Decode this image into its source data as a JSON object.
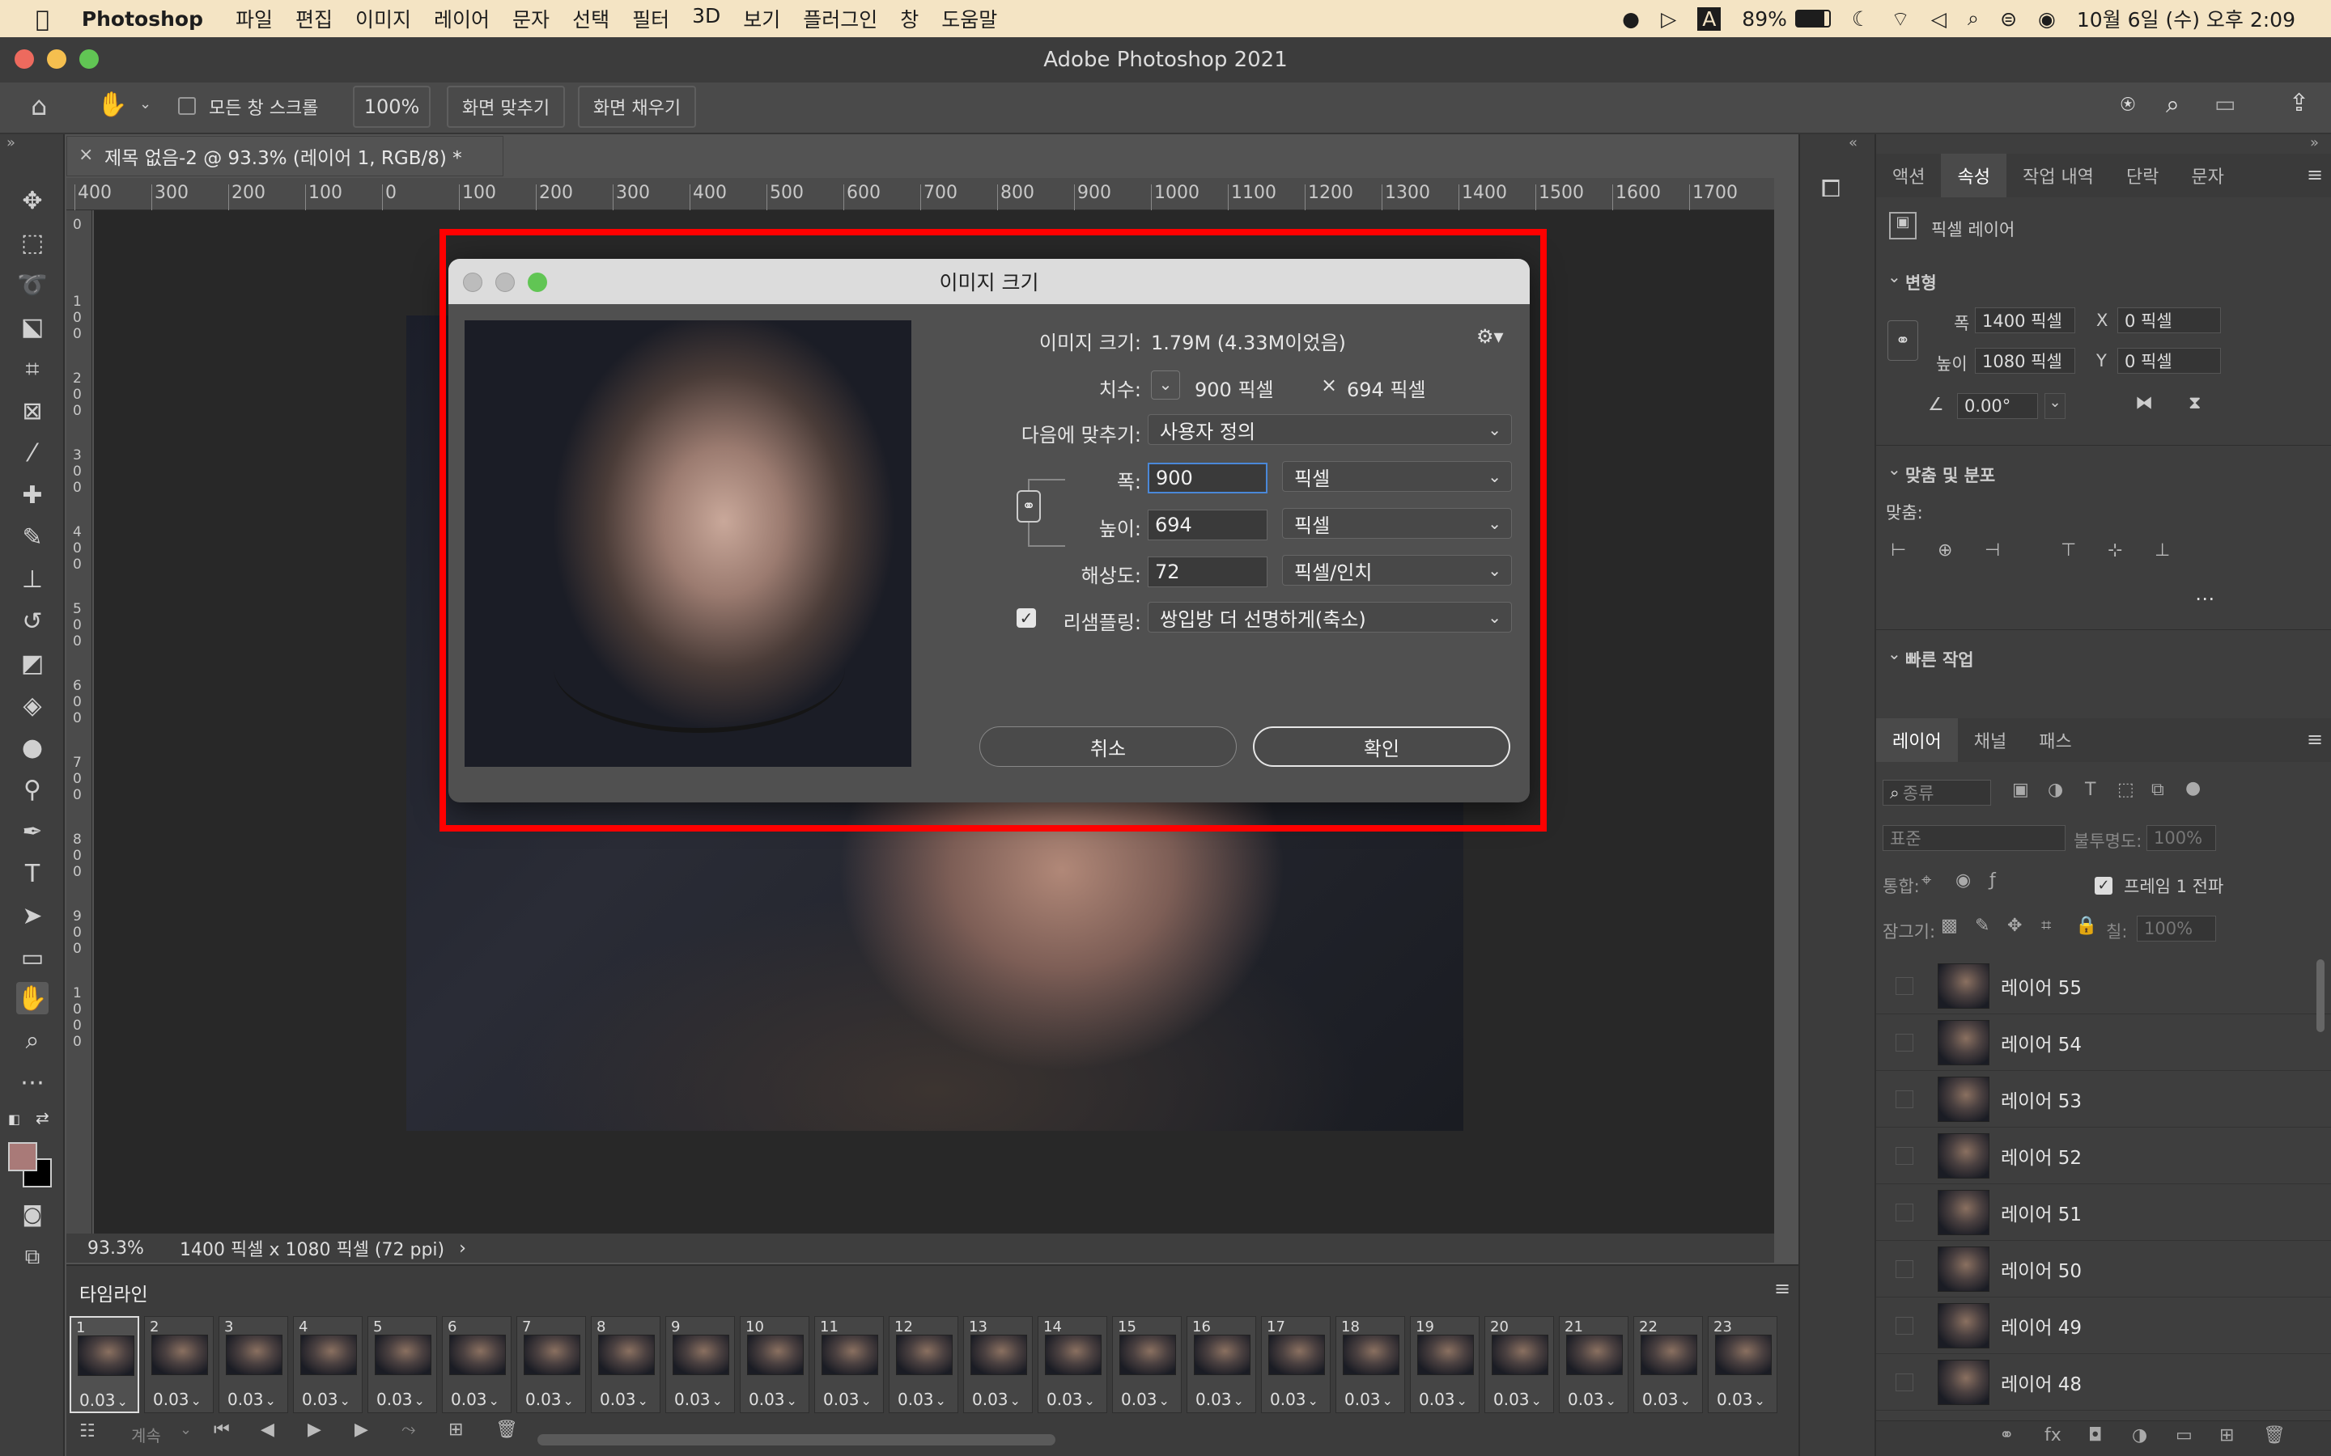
{
  "menubar": {
    "app": "Photoshop",
    "items": [
      "파일",
      "편집",
      "이미지",
      "레이어",
      "문자",
      "선택",
      "필터",
      "3D",
      "보기",
      "플러그인",
      "창",
      "도움말"
    ],
    "battery": "89%",
    "datetime": "10월 6일 (수) 오후 2:09"
  },
  "window": {
    "title": "Adobe Photoshop 2021"
  },
  "options": {
    "scroll_all_label": "모든 창 스크롤",
    "zoom_value": "100%",
    "fit_screen_label": "화면 맞추기",
    "fill_screen_label": "화면 채우기"
  },
  "document": {
    "tab_title": "제목 없음-2 @ 93.3% (레이어 1, RGB/8) *",
    "zoom": "93.3%",
    "size_info": "1400 픽셀 x 1080 픽셀 (72 ppi)"
  },
  "ruler": {
    "h_ticks": [
      "400",
      "300",
      "200",
      "100",
      "0",
      "100",
      "200",
      "300",
      "400",
      "500",
      "600",
      "700",
      "800",
      "900",
      "1000",
      "1100",
      "1200",
      "1300",
      "1400",
      "1500",
      "1600",
      "1700"
    ],
    "v_ticks": [
      "0",
      "100",
      "200",
      "300",
      "400",
      "500",
      "600",
      "700",
      "800",
      "900",
      "1000"
    ]
  },
  "dialog": {
    "title": "이미지 크기",
    "image_size_label": "이미지 크기:",
    "image_size_value": "1.79M (4.33M이었음)",
    "dimensions_label": "치수:",
    "dimensions_value_w": "900 픽셀",
    "dimensions_x": "×",
    "dimensions_value_h": "694 픽셀",
    "fit_label": "다음에 맞추기:",
    "fit_value": "사용자 정의",
    "width_label": "폭:",
    "width_value": "900",
    "width_unit": "픽셀",
    "height_label": "높이:",
    "height_value": "694",
    "height_unit": "픽셀",
    "resolution_label": "해상도:",
    "resolution_value": "72",
    "resolution_unit": "픽셀/인치",
    "resample_label": "리샘플링:",
    "resample_checked": true,
    "resample_value": "쌍입방 더 선명하게(축소)",
    "cancel_label": "취소",
    "ok_label": "확인"
  },
  "properties": {
    "tabs": [
      "액션",
      "속성",
      "작업 내역",
      "단락",
      "문자"
    ],
    "active_tab": "속성",
    "layer_type": "픽셀 레이어",
    "transform_header": "변형",
    "w_label": "폭",
    "w_value": "1400 픽셀",
    "h_label": "높이",
    "h_value": "1080 픽셀",
    "x_label": "X",
    "x_value": "0 픽셀",
    "y_label": "Y",
    "y_value": "0 픽셀",
    "angle_value": "0.00°",
    "align_header": "맞춤 및 분포",
    "align_label": "맞춤:",
    "quick_header": "빠른 작업"
  },
  "layers_panel": {
    "tabs": [
      "레이어",
      "채널",
      "패스"
    ],
    "filter_label": "종류",
    "blend_mode": "표준",
    "opacity_label": "불투명도:",
    "opacity_value": "100%",
    "unify_label": "통합:",
    "propagate_label": "프레임 1 전파",
    "lock_label": "잠그기:",
    "fill_label": "칠:",
    "fill_value": "100%",
    "layers": [
      "레이어 55",
      "레이어 54",
      "레이어 53",
      "레이어 52",
      "레이어 51",
      "레이어 50",
      "레이어 49",
      "레이어 48"
    ]
  },
  "timeline": {
    "title": "타임라인",
    "loop_label": "계속",
    "frames": [
      {
        "n": "1",
        "d": "0.03"
      },
      {
        "n": "2",
        "d": "0.03"
      },
      {
        "n": "3",
        "d": "0.03"
      },
      {
        "n": "4",
        "d": "0.03"
      },
      {
        "n": "5",
        "d": "0.03"
      },
      {
        "n": "6",
        "d": "0.03"
      },
      {
        "n": "7",
        "d": "0.03"
      },
      {
        "n": "8",
        "d": "0.03"
      },
      {
        "n": "9",
        "d": "0.03"
      },
      {
        "n": "10",
        "d": "0.03"
      },
      {
        "n": "11",
        "d": "0.03"
      },
      {
        "n": "12",
        "d": "0.03"
      },
      {
        "n": "13",
        "d": "0.03"
      },
      {
        "n": "14",
        "d": "0.03"
      },
      {
        "n": "15",
        "d": "0.03"
      },
      {
        "n": "16",
        "d": "0.03"
      },
      {
        "n": "17",
        "d": "0.03"
      },
      {
        "n": "18",
        "d": "0.03"
      },
      {
        "n": "19",
        "d": "0.03"
      },
      {
        "n": "20",
        "d": "0.03"
      },
      {
        "n": "21",
        "d": "0.03"
      },
      {
        "n": "22",
        "d": "0.03"
      },
      {
        "n": "23",
        "d": "0.03"
      }
    ]
  },
  "colors": {
    "highlight_box": "#ff0000",
    "foreground_swatch": "#a97a78",
    "background_swatch": "#000000"
  }
}
